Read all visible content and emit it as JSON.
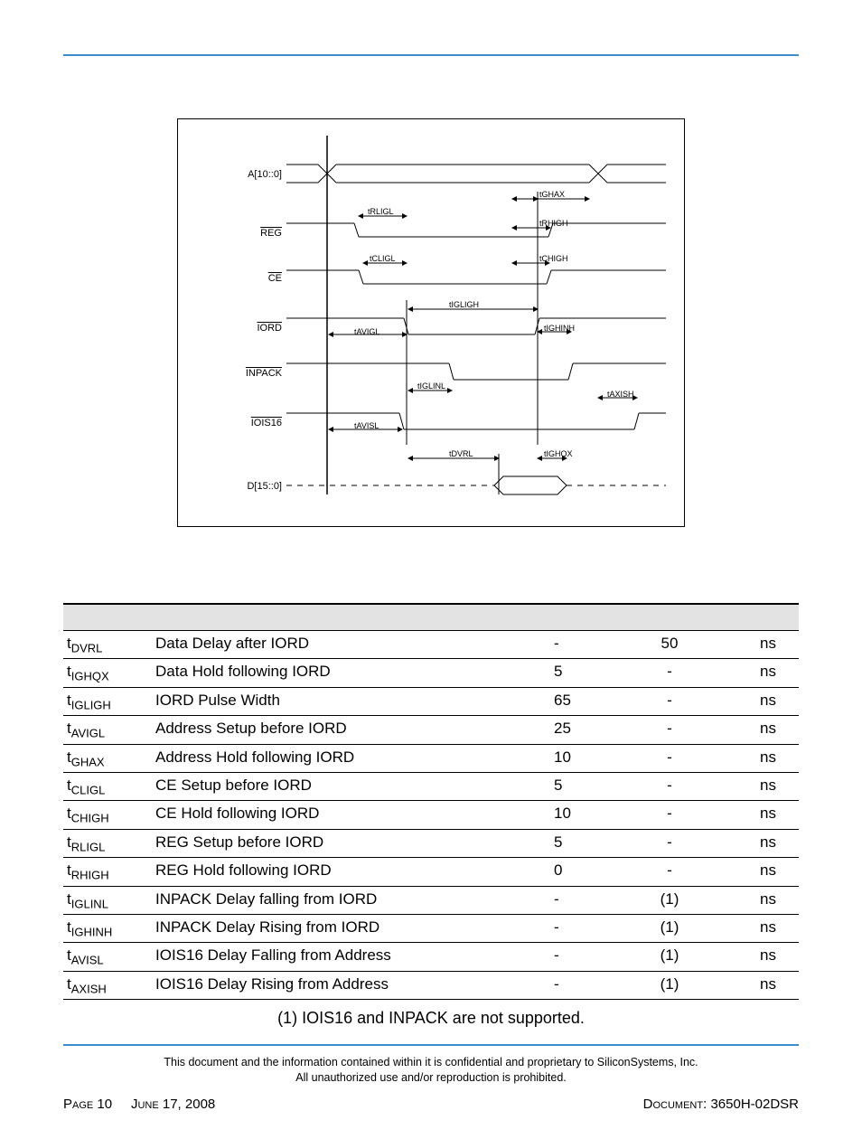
{
  "timing_diagram": {
    "signals": [
      "A[10::0]",
      "REG",
      "CE",
      "IORD",
      "INPACK",
      "IOIS16",
      "D[15::0]"
    ],
    "labels": [
      "tGHAX",
      "tRLIGL",
      "tRHIGH",
      "tCLIGL",
      "tCHIGH",
      "tIGLIGH",
      "tAVIGL",
      "tIGHINH",
      "tIGLINL",
      "tAXISH",
      "tAVISL",
      "tDVRL",
      "tIGHQX"
    ]
  },
  "table": {
    "rows": [
      {
        "sym": "DVRL",
        "desc": "Data Delay after IORD",
        "min": "-",
        "max": "50",
        "unit": "ns"
      },
      {
        "sym": "IGHQX",
        "desc": "Data Hold following IORD",
        "min": "5",
        "max": "-",
        "unit": "ns"
      },
      {
        "sym": "IGLIGH",
        "desc": "IORD Pulse Width",
        "min": "65",
        "max": "-",
        "unit": "ns"
      },
      {
        "sym": "AVIGL",
        "desc": "Address Setup before IORD",
        "min": "25",
        "max": "-",
        "unit": "ns"
      },
      {
        "sym": "GHAX",
        "desc": "Address Hold following IORD",
        "min": "10",
        "max": "-",
        "unit": "ns"
      },
      {
        "sym": "CLIGL",
        "desc": "CE Setup before IORD",
        "min": "5",
        "max": "-",
        "unit": "ns"
      },
      {
        "sym": "CHIGH",
        "desc": "CE Hold following IORD",
        "min": "10",
        "max": "-",
        "unit": "ns"
      },
      {
        "sym": "RLIGL",
        "desc": "REG Setup before IORD",
        "min": "5",
        "max": "-",
        "unit": "ns"
      },
      {
        "sym": "RHIGH",
        "desc": "REG Hold following IORD",
        "min": "0",
        "max": "-",
        "unit": "ns"
      },
      {
        "sym": "IGLINL",
        "desc": "INPACK Delay falling from IORD",
        "min": "-",
        "max": "(1)",
        "unit": "ns"
      },
      {
        "sym": "IGHINH",
        "desc": "INPACK Delay Rising from IORD",
        "min": "-",
        "max": "(1)",
        "unit": "ns"
      },
      {
        "sym": "AVISL",
        "desc": "IOIS16 Delay Falling from Address",
        "min": "-",
        "max": "(1)",
        "unit": "ns"
      },
      {
        "sym": "AXISH",
        "desc": "IOIS16 Delay Rising from Address",
        "min": "-",
        "max": "(1)",
        "unit": "ns"
      }
    ]
  },
  "footnote": "(1) IOIS16 and INPACK are not supported.",
  "disclaimer_line1": "This document and the information contained within it is confidential and proprietary to SiliconSystems, Inc.",
  "disclaimer_line2": "All unauthorized use and/or reproduction is prohibited.",
  "footer": {
    "page_word": "Page",
    "page_num": "10",
    "date_month": "June",
    "date_rest": "17, 2008",
    "doc_word": "Document",
    "doc_id": ": 3650H-02DSR"
  }
}
